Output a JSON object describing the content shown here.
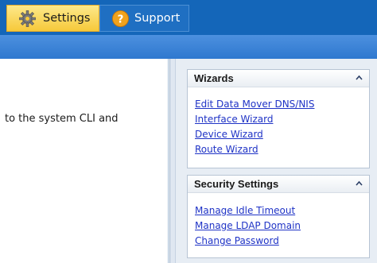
{
  "tabs": [
    {
      "label": "Settings",
      "icon": "gear-icon",
      "active": true
    },
    {
      "label": "Support",
      "icon": "help-icon",
      "active": false
    }
  ],
  "main": {
    "text": "to the system CLI and"
  },
  "wizards": {
    "title": "Wizards",
    "links": [
      "Edit Data Mover DNS/NIS",
      "Interface Wizard",
      "Device Wizard",
      "Route Wizard"
    ]
  },
  "security": {
    "title": "Security Settings",
    "links": [
      "Manage Idle Timeout",
      "Manage LDAP Domain",
      "Change Password"
    ]
  },
  "colors": {
    "nav_bar": "#1466b9",
    "active_tab": "#f6c93a",
    "link": "#1f33c6"
  }
}
